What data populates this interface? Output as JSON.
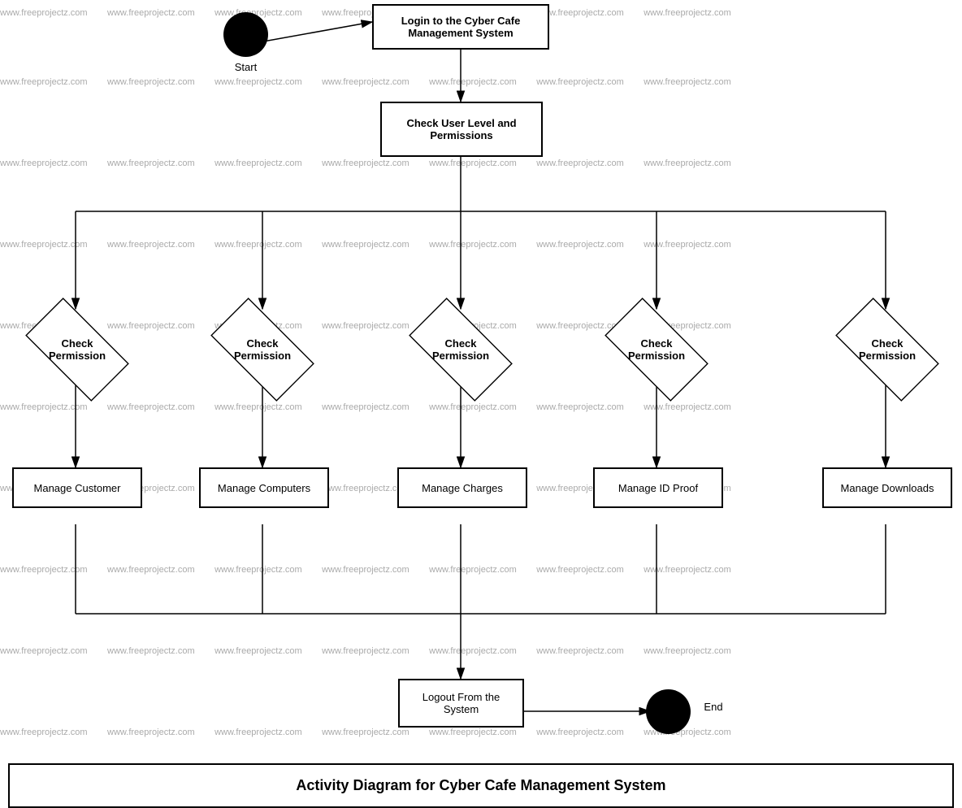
{
  "watermarks": [
    "www.freeprojectz.com"
  ],
  "diagram": {
    "title": "Activity Diagram for Cyber Cafe Management System",
    "start_label": "Start",
    "end_label": "End",
    "nodes": {
      "login": "Login to the Cyber Cafe\nManagement System",
      "check_user_level": "Check User Level and\nPermissions",
      "check_perm_1": "Check\nPermission",
      "check_perm_2": "Check\nPermission",
      "check_perm_3": "Check\nPermission",
      "check_perm_4": "Check\nPermission",
      "check_perm_5": "Check\nPermission",
      "manage_customer": "Manage Customer",
      "manage_computers": "Manage Computers",
      "manage_charges": "Manage Charges",
      "manage_id_proof": "Manage ID Proof",
      "manage_downloads": "Manage Downloads",
      "logout": "Logout From the\nSystem"
    }
  }
}
